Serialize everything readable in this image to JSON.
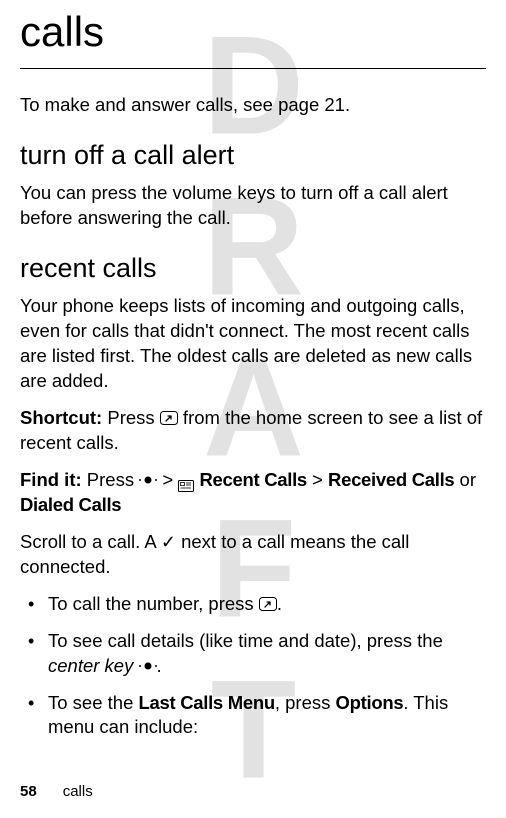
{
  "watermark": "DRAFT",
  "title": "calls",
  "intro": "To make and answer calls, see page 21.",
  "section1": {
    "heading": "turn off a call alert",
    "body": "You can press the volume keys to turn off a call alert before answering the call."
  },
  "section2": {
    "heading": "recent calls",
    "body1": "Your phone keeps lists of incoming and outgoing calls, even for calls that didn't connect. The most recent calls are listed first. The oldest calls are deleted as new calls are added.",
    "shortcut_label": "Shortcut:",
    "shortcut_pre": " Press ",
    "shortcut_post": " from the home screen to see a list of recent calls.",
    "findit_label": "Find it:",
    "findit_pre": " Press ",
    "findit_gt1": " > ",
    "findit_recent": "Recent Calls",
    "findit_gt2": " > ",
    "findit_received": "Received Calls",
    "findit_or": " or ",
    "findit_dialed": "Dialed Calls",
    "scroll_pre": "Scroll to a call. A ",
    "scroll_post": " next to a call means the call connected.",
    "bullets": {
      "b1_pre": "To call the number, press ",
      "b1_post": ".",
      "b2_pre": "To see call details (like time and date), press the ",
      "b2_italic": "center key",
      "b2_post": ".",
      "b3_pre": "To see the ",
      "b3_menu": "Last Calls Menu",
      "b3_mid": ", press ",
      "b3_options": "Options",
      "b3_post": ". This menu can include:"
    }
  },
  "footer": {
    "page": "58",
    "section": "calls"
  },
  "icons": {
    "send": "↗",
    "check": "✓"
  }
}
